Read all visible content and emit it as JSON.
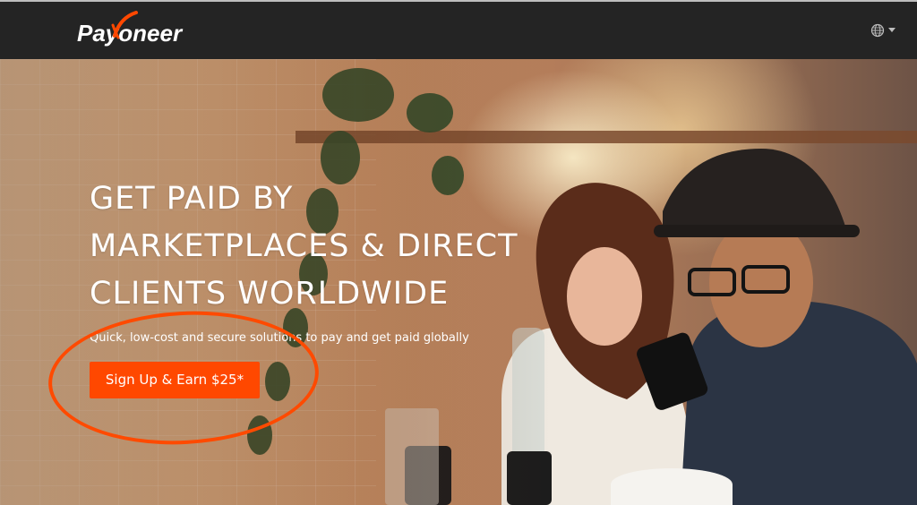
{
  "header": {
    "logo_text": "Payoneer",
    "logo_color": "#ff4800",
    "language_icon": "globe-icon",
    "dropdown_icon": "caret-down-icon"
  },
  "hero": {
    "headline": [
      "GET PAID BY",
      "MARKETPLACES & DIRECT",
      "CLIENTS WORLDWIDE"
    ],
    "subheadline": "Quick, low-cost and secure solutions to pay and get paid globally",
    "cta_label": "Sign Up & Earn $25*",
    "cta_color": "#ff4800",
    "annotation_color": "#ff4a00"
  }
}
